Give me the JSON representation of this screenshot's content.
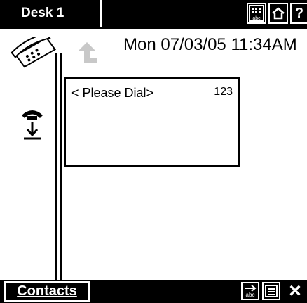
{
  "top_bar": {
    "title": "Desk 1",
    "help_label": "?"
  },
  "header": {
    "datetime": "Mon 07/03/05 11:34AM"
  },
  "dial_box": {
    "prompt": "< Please Dial>",
    "count": "123"
  },
  "bottom_bar": {
    "contacts_label": "Contacts",
    "close_label": "×"
  },
  "icons": [
    "keypad-abc-icon",
    "home-icon",
    "help-icon",
    "phone-icon",
    "back-arrow-icon",
    "handset-down-icon",
    "abc-arrow-icon",
    "list-icon",
    "close-icon"
  ]
}
